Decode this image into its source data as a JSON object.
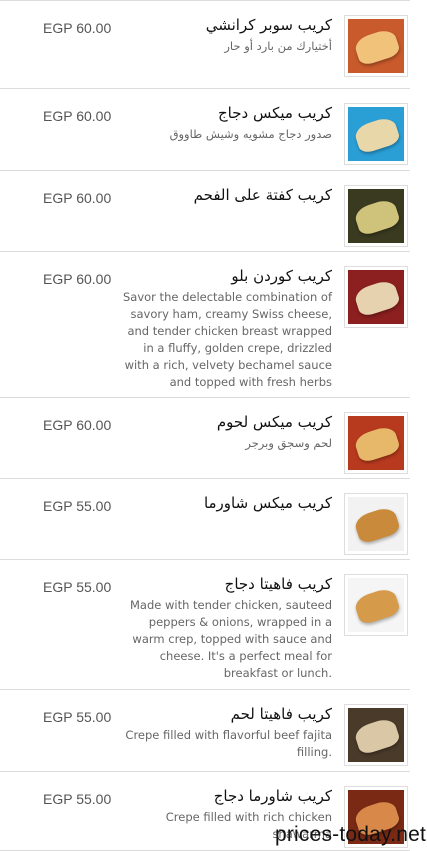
{
  "items": [
    {
      "price": "EGP 60.00",
      "title": "كريب سوبر كرانشي",
      "desc": "أختيارك من بارد أو حار",
      "desc_ltr": false,
      "img": {
        "bg": "#c85a2c",
        "fg": "#f0c27a"
      }
    },
    {
      "price": "EGP 60.00",
      "title": "كريب ميكس دجاج",
      "desc": "صدور دجاج مشويه وشيش طاووق",
      "desc_ltr": false,
      "img": {
        "bg": "#2a9fd6",
        "fg": "#e8d7a8"
      }
    },
    {
      "price": "EGP 60.00",
      "title": "كريب كفتة على الفحم",
      "desc": "",
      "desc_ltr": false,
      "img": {
        "bg": "#3a3a20",
        "fg": "#cfc27a"
      }
    },
    {
      "price": "EGP 60.00",
      "title": "كريب كوردن بلو",
      "desc": "Savor the delectable combination of savory ham, creamy Swiss cheese, and tender chicken breast wrapped in a fluffy, golden crepe, drizzled with a rich, velvety bechamel sauce and topped with fresh herbs",
      "desc_ltr": true,
      "img": {
        "bg": "#8c1f1f",
        "fg": "#e7d2b0"
      }
    },
    {
      "price": "EGP 60.00",
      "title": "كريب ميكس لحوم",
      "desc": "لحم وسجق وبرجر",
      "desc_ltr": false,
      "img": {
        "bg": "#b83a1e",
        "fg": "#e8b86a"
      }
    },
    {
      "price": "EGP 55.00",
      "title": "كريب ميكس شاورما",
      "desc": "",
      "desc_ltr": false,
      "img": {
        "bg": "#f2f2f2",
        "fg": "#c98a3c"
      }
    },
    {
      "price": "EGP 55.00",
      "title": "كريب فاهيتا دجاج",
      "desc": "Made with tender chicken, sauteed peppers & onions, wrapped in a warm crep, topped with sauce and cheese. It's a perfect meal for breakfast or lunch.",
      "desc_ltr": true,
      "img": {
        "bg": "#f5f5f5",
        "fg": "#d59a4a"
      }
    },
    {
      "price": "EGP 55.00",
      "title": "كريب فاهيتا لحم",
      "desc": "Crepe filled with flavorful beef fajita filling.",
      "desc_ltr": true,
      "img": {
        "bg": "#4a3a2a",
        "fg": "#d9c7a6"
      }
    },
    {
      "price": "EGP 55.00",
      "title": "كريب شاورما دجاج",
      "desc": "Crepe filled with rich chicken shawarma",
      "desc_ltr": true,
      "img": {
        "bg": "#7a2a14",
        "fg": "#d8894a"
      }
    }
  ],
  "watermark": "prices-today.net"
}
